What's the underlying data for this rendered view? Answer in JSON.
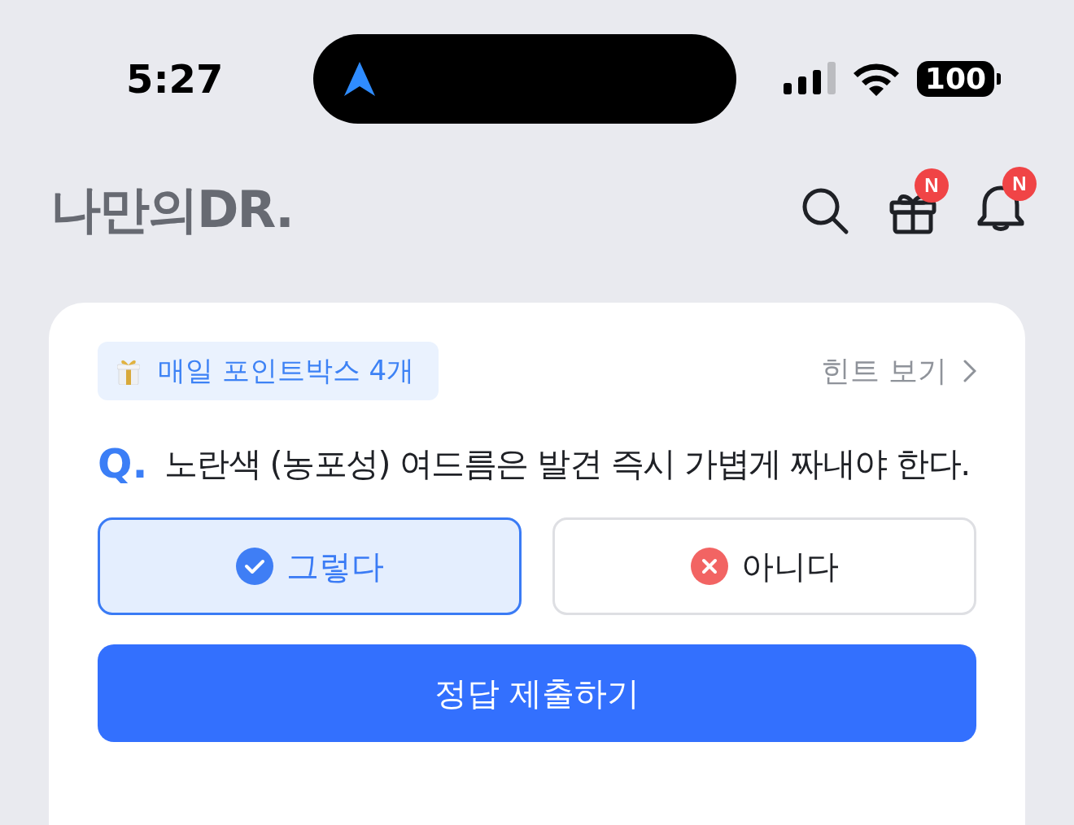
{
  "status_bar": {
    "time": "5:27",
    "battery": "100"
  },
  "header": {
    "logo": "나만의DR.",
    "badges": [
      {
        "kind": "gift",
        "label": "N"
      },
      {
        "kind": "bell",
        "label": "N"
      }
    ]
  },
  "quiz": {
    "point_box": "매일 포인트박스 4개",
    "hint_link": "힌트 보기",
    "question_mark": "Q.",
    "question": "노란색 (농포성) 여드름은 발견 즉시 가볍게 짜내야 한다.",
    "options": [
      {
        "kind": "yes",
        "label": "그렇다",
        "selected": true
      },
      {
        "kind": "no",
        "label": "아니다",
        "selected": false
      }
    ],
    "submit": "정답 제출하기"
  }
}
